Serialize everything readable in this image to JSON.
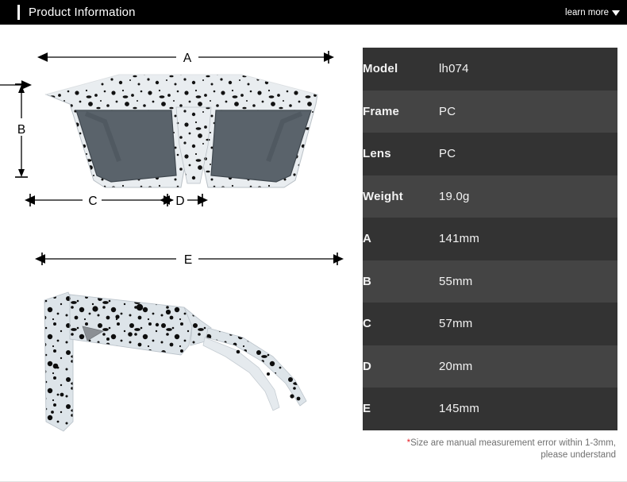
{
  "header": {
    "title": "Product Information",
    "learn_more_label": "learn more",
    "caret_icon": "chevron-down-icon",
    "background_color": "#000000",
    "accent_color": "#ffffff"
  },
  "diagram": {
    "front_view": {
      "name": "sunglasses-front-view",
      "frame_color": "#e8ecef",
      "speckle_color": "#111111",
      "lens_color": "#5a636b"
    },
    "side_view": {
      "name": "sunglasses-side-view",
      "frame_color": "#dce3e8",
      "speckle_color": "#0d0d0d",
      "logo_color": "#8b8f94"
    },
    "dimension_labels": {
      "a": "A",
      "b": "B",
      "c": "C",
      "d": "D",
      "e": "E"
    }
  },
  "spec_table": {
    "row_color_odd": "#333333",
    "row_color_even": "#444444",
    "rows": [
      {
        "label": "Model",
        "value": "lh074"
      },
      {
        "label": "Frame",
        "value": "PC"
      },
      {
        "label": "Lens",
        "value": "PC"
      },
      {
        "label": "Weight",
        "value": "19.0g"
      },
      {
        "label": "A",
        "value": "141mm"
      },
      {
        "label": "B",
        "value": "55mm"
      },
      {
        "label": "C",
        "value": "57mm"
      },
      {
        "label": "D",
        "value": "20mm"
      },
      {
        "label": "E",
        "value": "145mm"
      }
    ]
  },
  "footnote": {
    "asterisk": "*",
    "line1": "Size are manual measurement error within 1-3mm,",
    "line2": "please understand",
    "asterisk_color": "#e8242a"
  }
}
